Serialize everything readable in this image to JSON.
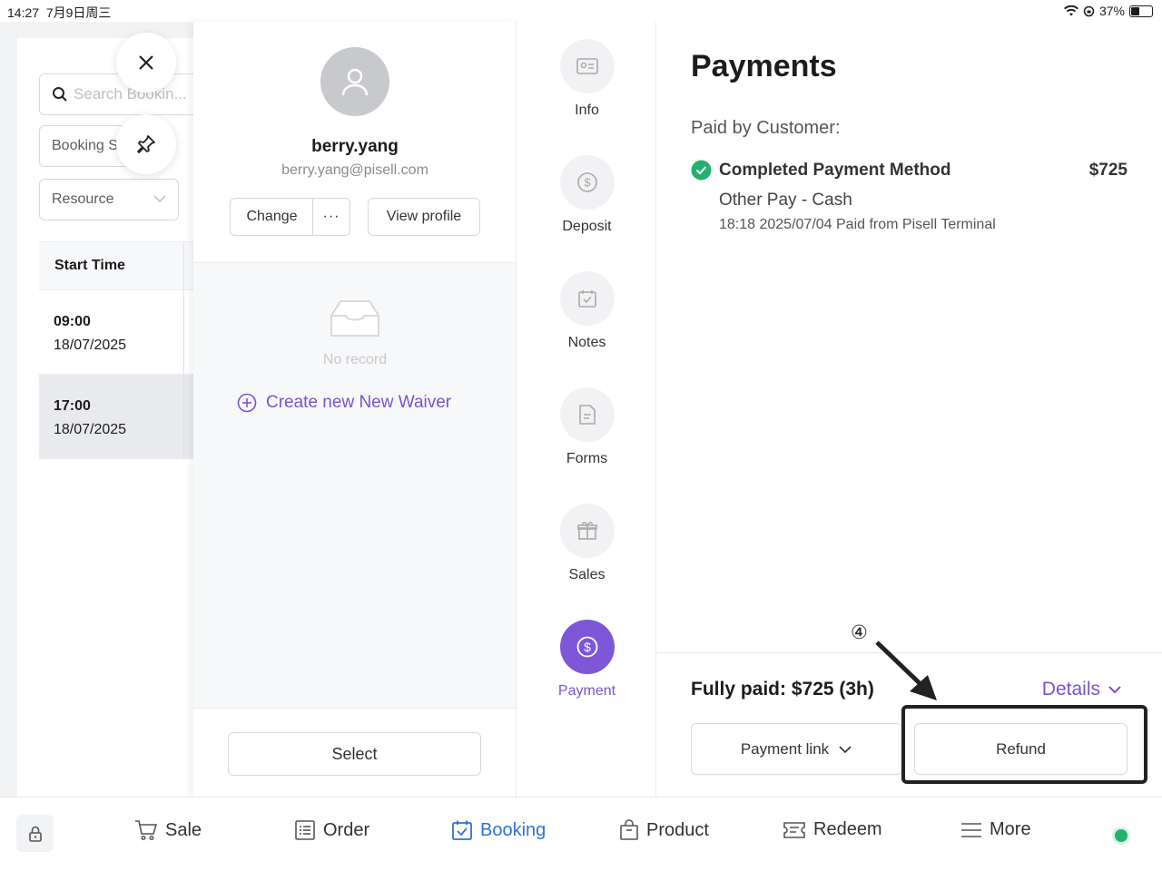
{
  "status_bar": {
    "time": "14:27",
    "date": "7月9日周三",
    "battery": "37%"
  },
  "booking_list": {
    "search_placeholder": "Search Bookin...",
    "booking_filter": "Booking S",
    "resource_filter": "Resource",
    "column_start_time": "Start Time",
    "rows": [
      {
        "time": "09:00",
        "date": "18/07/2025"
      },
      {
        "time": "17:00",
        "date": "18/07/2025"
      }
    ]
  },
  "customer": {
    "name": "berry.yang",
    "email": "berry.yang@pisell.com",
    "change_label": "Change",
    "more_label": "···",
    "view_profile_label": "View profile",
    "no_record": "No record",
    "create_waiver": "Create new New Waiver",
    "select_label": "Select"
  },
  "tabs": [
    {
      "label": "Info",
      "icon": "id-card-icon"
    },
    {
      "label": "Deposit",
      "icon": "dollar-icon"
    },
    {
      "label": "Notes",
      "icon": "calendar-check-icon"
    },
    {
      "label": "Forms",
      "icon": "document-icon"
    },
    {
      "label": "Sales",
      "icon": "gift-icon"
    },
    {
      "label": "Payment",
      "icon": "dollar-icon"
    }
  ],
  "payments": {
    "title": "Payments",
    "paid_by": "Paid by Customer:",
    "method_label": "Completed Payment Method",
    "amount": "$725",
    "method_detail": "Other Pay - Cash",
    "method_time": "18:18 2025/07/04 Paid from Pisell Terminal",
    "fully_paid": "Fully paid: $725 (3h)",
    "details_label": "Details",
    "payment_link_label": "Payment link",
    "refund_label": "Refund",
    "step_marker": "④"
  },
  "bottom_nav": {
    "items": [
      "Sale",
      "Order",
      "Booking",
      "Product",
      "Redeem",
      "More"
    ],
    "active": "Booking"
  },
  "colors": {
    "accent_purple": "#7d57d8",
    "active_blue": "#2f6fe0",
    "success_green": "#23b26d"
  }
}
